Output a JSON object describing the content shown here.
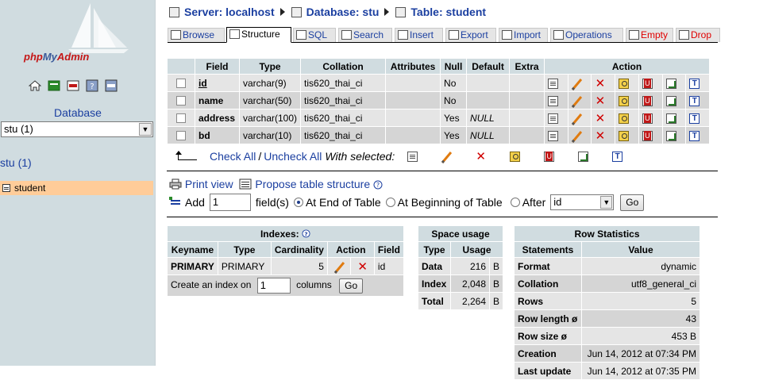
{
  "logo": {
    "part1": "php",
    "part2": "My",
    "part3": "Admin"
  },
  "nav": {
    "database_label": "Database",
    "database_select_value": "stu (1)",
    "database_link": "stu (1)",
    "tables": [
      {
        "name": "student"
      }
    ]
  },
  "breadcrumb": {
    "server": "Server: localhost",
    "database": "Database: stu",
    "table": "Table: student"
  },
  "tabs": [
    {
      "label": "Browse"
    },
    {
      "label": "Structure"
    },
    {
      "label": "SQL"
    },
    {
      "label": "Search"
    },
    {
      "label": "Insert"
    },
    {
      "label": "Export"
    },
    {
      "label": "Import"
    },
    {
      "label": "Operations"
    },
    {
      "label": "Empty"
    },
    {
      "label": "Drop"
    }
  ],
  "structure": {
    "headers": [
      "Field",
      "Type",
      "Collation",
      "Attributes",
      "Null",
      "Default",
      "Extra",
      "Action"
    ],
    "rows": [
      {
        "field": "id",
        "type": "varchar(9)",
        "collation": "tis620_thai_ci",
        "attributes": "",
        "null": "No",
        "default": "",
        "extra": ""
      },
      {
        "field": "name",
        "type": "varchar(50)",
        "collation": "tis620_thai_ci",
        "attributes": "",
        "null": "No",
        "default": "",
        "extra": ""
      },
      {
        "field": "address",
        "type": "varchar(100)",
        "collation": "tis620_thai_ci",
        "attributes": "",
        "null": "Yes",
        "default": "NULL",
        "extra": ""
      },
      {
        "field": "bd",
        "type": "varchar(10)",
        "collation": "tis620_thai_ci",
        "attributes": "",
        "null": "Yes",
        "default": "NULL",
        "extra": ""
      }
    ],
    "check_all": "Check All",
    "separator": "/",
    "uncheck_all": "Uncheck All",
    "with_selected": "With selected:"
  },
  "tools": {
    "print_view": "Print view",
    "propose": "Propose table structure"
  },
  "add_fields": {
    "add_label": "Add",
    "count_value": "1",
    "fields_label": "field(s)",
    "at_end": "At End of Table",
    "at_beginning": "At Beginning of Table",
    "after": "After",
    "after_value": "id",
    "go": "Go"
  },
  "indexes": {
    "title": "Indexes:",
    "headers": [
      "Keyname",
      "Type",
      "Cardinality",
      "Action",
      "Field"
    ],
    "rows": [
      {
        "keyname": "PRIMARY",
        "type": "PRIMARY",
        "cardinality": "5",
        "field": "id"
      }
    ],
    "create_prefix": "Create an index on",
    "create_value": "1",
    "create_suffix": "columns",
    "go": "Go"
  },
  "space_usage": {
    "title": "Space usage",
    "headers": [
      "Type",
      "Usage"
    ],
    "rows": [
      {
        "type": "Data",
        "value": "216",
        "unit": "B"
      },
      {
        "type": "Index",
        "value": "2,048",
        "unit": "B"
      },
      {
        "type": "Total",
        "value": "2,264",
        "unit": "B"
      }
    ]
  },
  "row_stats": {
    "title": "Row Statistics",
    "headers": [
      "Statements",
      "Value"
    ],
    "rows": [
      {
        "statement": "Format",
        "value": "dynamic"
      },
      {
        "statement": "Collation",
        "value": "utf8_general_ci"
      },
      {
        "statement": "Rows",
        "value": "5"
      },
      {
        "statement": "Row length ø",
        "value": "43"
      },
      {
        "statement": "Row size ø",
        "value": "453 B"
      },
      {
        "statement": "Creation",
        "value": "Jun 14, 2012 at 07:34 PM"
      },
      {
        "statement": "Last update",
        "value": "Jun 14, 2012 at 07:35 PM"
      }
    ]
  }
}
